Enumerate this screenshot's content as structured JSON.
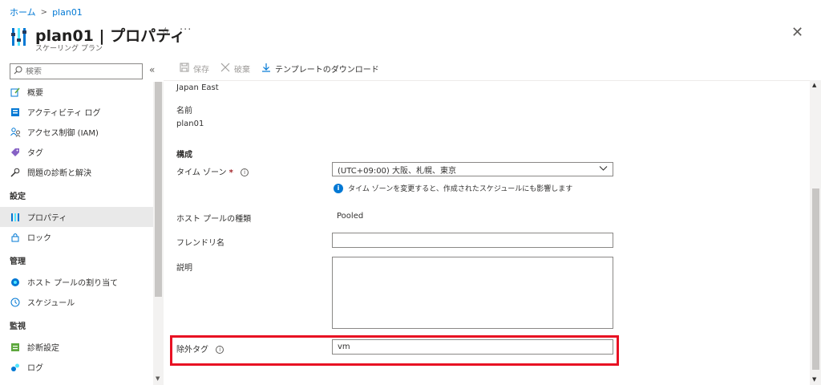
{
  "breadcrumb": {
    "home": "ホーム",
    "current": "plan01"
  },
  "header": {
    "title": "plan01 | プロパティ",
    "subtitle": "スケーリング プラン",
    "star_icon": "star-icon",
    "more_icon": "more-icon",
    "close_icon": "close-icon"
  },
  "search": {
    "placeholder": "検索"
  },
  "sidebar": {
    "items_top": [
      {
        "label": "概要",
        "icon": "overview-icon"
      },
      {
        "label": "アクティビティ ログ",
        "icon": "activity-log-icon"
      },
      {
        "label": "アクセス制御 (IAM)",
        "icon": "iam-icon"
      },
      {
        "label": "タグ",
        "icon": "tag-icon"
      },
      {
        "label": "問題の診断と解決",
        "icon": "wrench-icon"
      }
    ],
    "section_settings": "設定",
    "items_settings": [
      {
        "label": "プロパティ",
        "icon": "properties-icon",
        "selected": true
      },
      {
        "label": "ロック",
        "icon": "lock-icon"
      }
    ],
    "section_manage": "管理",
    "items_manage": [
      {
        "label": "ホスト プールの割り当て",
        "icon": "host-pool-icon"
      },
      {
        "label": "スケジュール",
        "icon": "clock-icon"
      }
    ],
    "section_monitor": "監視",
    "items_monitor": [
      {
        "label": "診断設定",
        "icon": "diagnostic-icon"
      },
      {
        "label": "ログ",
        "icon": "logs-icon"
      }
    ]
  },
  "toolbar": {
    "save": "保存",
    "discard": "破棄",
    "download": "テンプレートのダウンロード"
  },
  "form": {
    "region_value": "Japan East",
    "name_label": "名前",
    "name_value": "plan01",
    "section_config": "構成",
    "timezone_label": "タイム ゾーン",
    "required_mark": "*",
    "timezone_value": "(UTC+09:00) 大阪、札幌、東京",
    "timezone_info": "タイム ゾーンを変更すると、作成されたスケジュールにも影響します",
    "host_pool_type_label": "ホスト プールの種類",
    "host_pool_type_value": "Pooled",
    "friendly_name_label": "フレンドリ名",
    "friendly_name_value": "",
    "description_label": "説明",
    "description_value": "",
    "exclusion_tag_label": "除外タグ",
    "exclusion_tag_value": "vm"
  },
  "colors": {
    "accent": "#0078d4",
    "highlight": "#e81123",
    "selected_bg": "#e9e9e9"
  }
}
